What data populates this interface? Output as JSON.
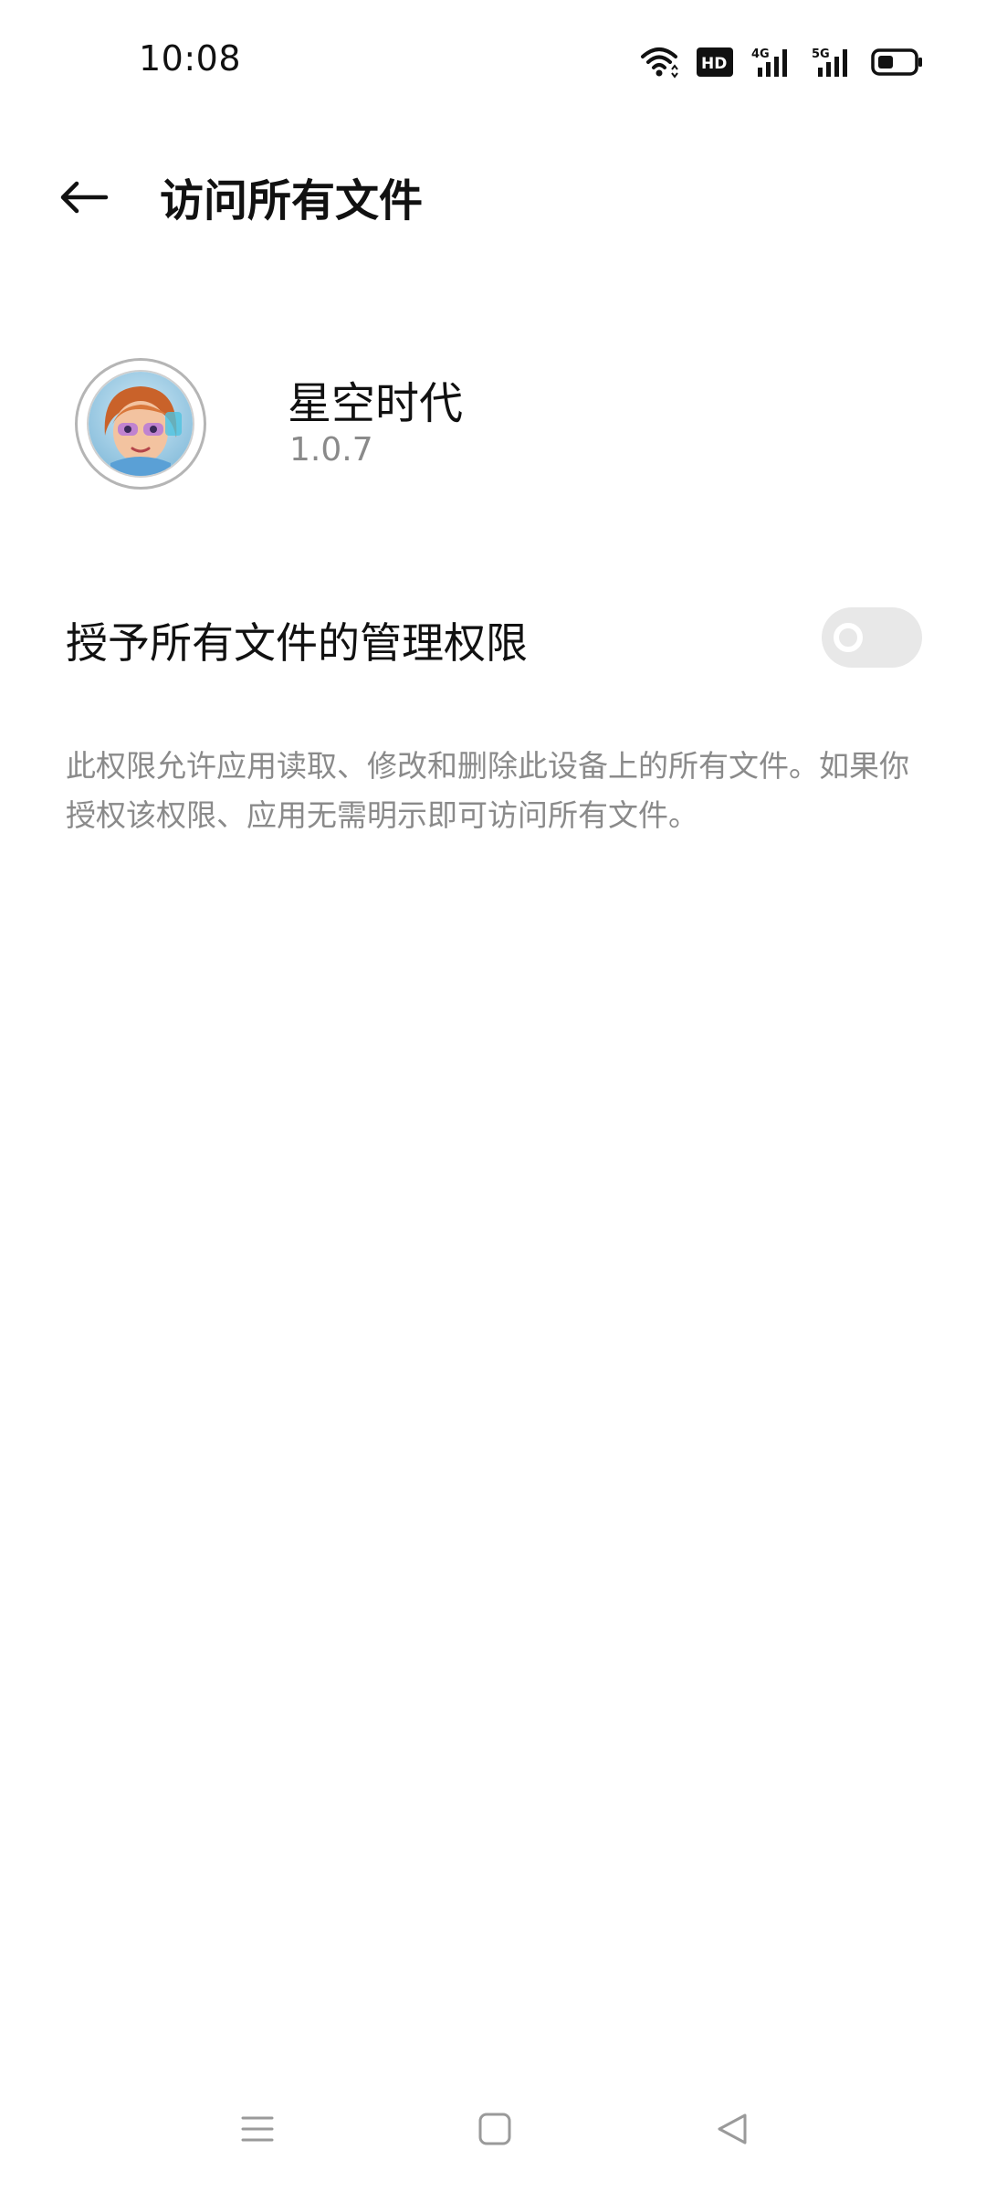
{
  "status_bar": {
    "time": "10:08",
    "icons": [
      "wifi-icon",
      "hd-icon",
      "4g-signal-icon",
      "5g-signal-icon",
      "battery-icon"
    ],
    "hd_label": "HD",
    "net1_label": "4G",
    "net2_label": "5G"
  },
  "header": {
    "title": "访问所有文件",
    "back_icon": "arrow-left-icon"
  },
  "app": {
    "name": "星空时代",
    "version": "1.0.7"
  },
  "permission": {
    "label": "授予所有文件的管理权限",
    "enabled": false,
    "description": "此权限允许应用读取、修改和删除此设备上的所有文件。如果你授权该权限、应用无需明示即可访问所有文件。"
  },
  "nav_bar": {
    "icons": [
      "menu-icon",
      "home-icon",
      "back-triangle-icon"
    ]
  },
  "colors": {
    "background": "#ffffff",
    "primary_text": "#111111",
    "secondary_text": "#8a8a8a",
    "toggle_off": "#e8e8e8"
  }
}
